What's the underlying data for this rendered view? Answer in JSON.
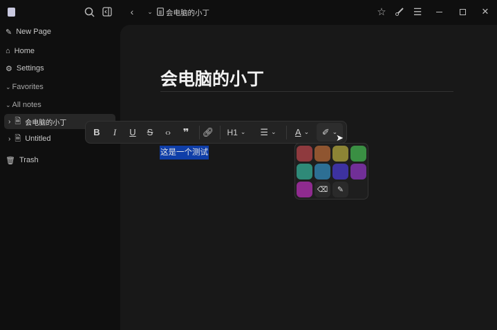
{
  "breadcrumb": {
    "title": "会电脑的小丁"
  },
  "sidebar": {
    "items": [
      {
        "label": "New Page",
        "icon": "edit-icon"
      },
      {
        "label": "Home",
        "icon": "home-icon"
      },
      {
        "label": "Settings",
        "icon": "gear-icon"
      }
    ],
    "favorites": "Favorites",
    "all_notes": "All notes",
    "notes": [
      {
        "label": "会电脑的小丁"
      },
      {
        "label": "Untitled"
      }
    ],
    "trash": "Trash"
  },
  "editor": {
    "title": "会电脑的小丁",
    "body": "这是一个测试"
  },
  "toolbar": {
    "heading": "H1"
  },
  "palette": {
    "colors": [
      "#8f3a3e",
      "#8f5530",
      "#8c8435",
      "#3a8f43",
      "#2f8a78",
      "#2d6f94",
      "#3d32a0",
      "#712f97",
      "#8f2b8f"
    ]
  }
}
